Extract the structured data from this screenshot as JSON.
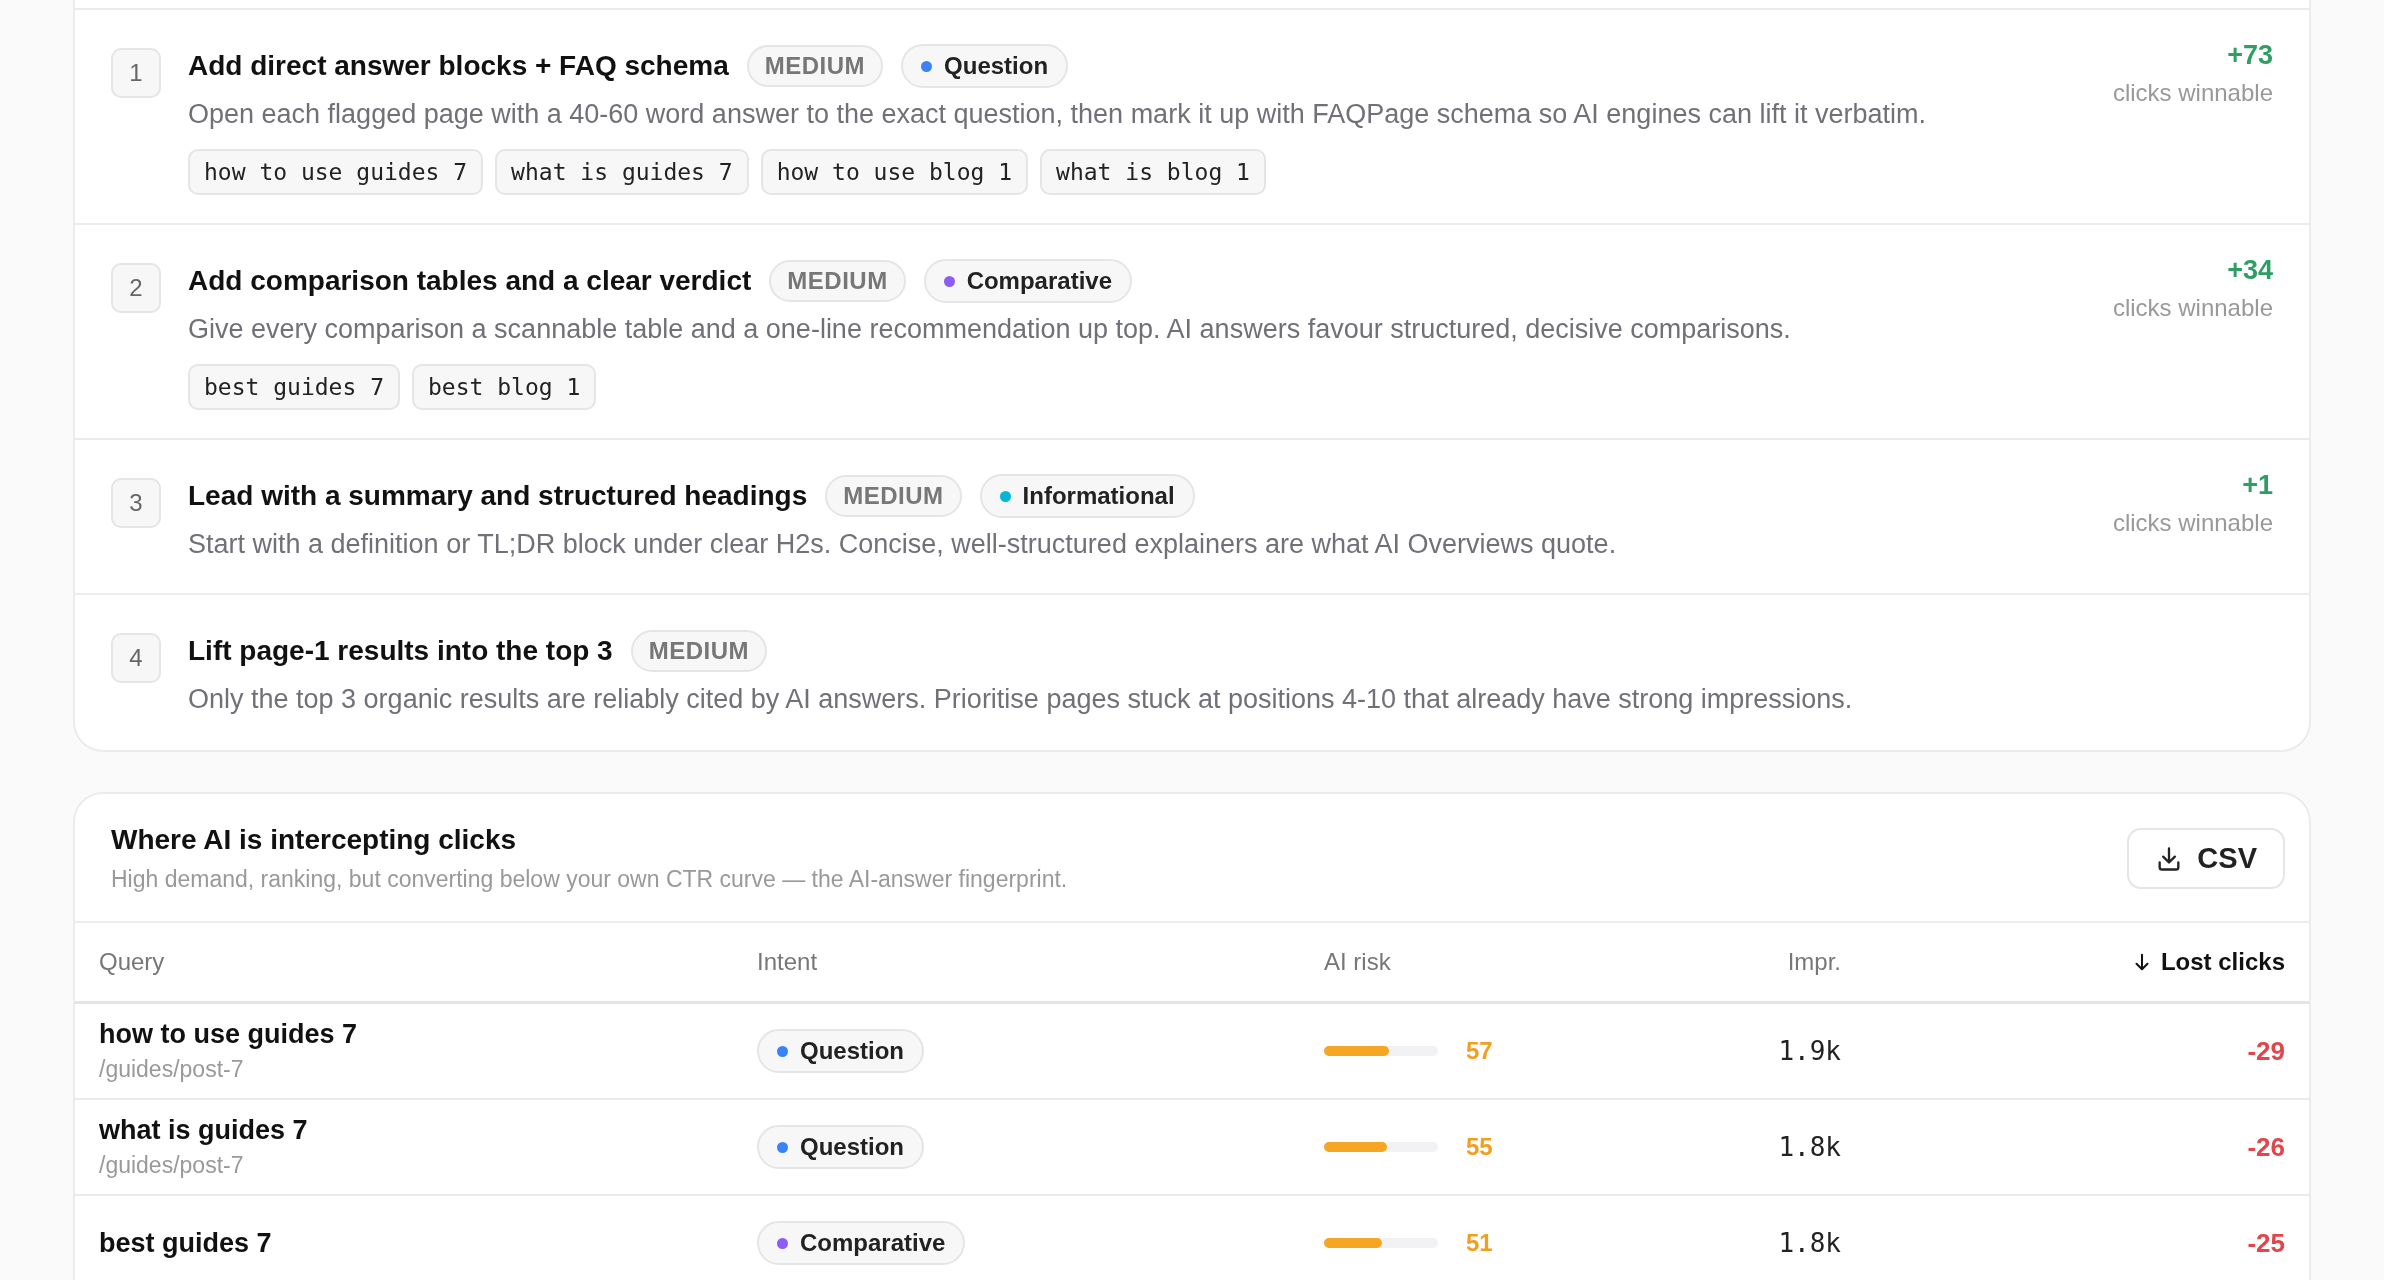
{
  "recommendations": [
    {
      "number": "1",
      "title": "Add direct answer blocks + FAQ schema",
      "effort": "MEDIUM",
      "intent": {
        "label": "Question",
        "color": "#3b82f6"
      },
      "description": "Open each flagged page with a 40-60 word answer to the exact question, then mark it up with FAQPage schema so AI engines can lift it verbatim.",
      "queries": [
        "how to use guides 7",
        "what is guides 7",
        "how to use blog 1",
        "what is blog 1"
      ],
      "gain": "+73",
      "gain_label": "clicks winnable"
    },
    {
      "number": "2",
      "title": "Add comparison tables and a clear verdict",
      "effort": "MEDIUM",
      "intent": {
        "label": "Comparative",
        "color": "#8b5cf6"
      },
      "description": "Give every comparison a scannable table and a one-line recommendation up top. AI answers favour structured, decisive comparisons.",
      "queries": [
        "best guides 7",
        "best blog 1"
      ],
      "gain": "+34",
      "gain_label": "clicks winnable"
    },
    {
      "number": "3",
      "title": "Lead with a summary and structured headings",
      "effort": "MEDIUM",
      "intent": {
        "label": "Informational",
        "color": "#06b6d4"
      },
      "description": "Start with a definition or TL;DR block under clear H2s. Concise, well-structured explainers are what AI Overviews quote.",
      "gain": "+1",
      "gain_label": "clicks winnable"
    },
    {
      "number": "4",
      "title": "Lift page-1 results into the top 3",
      "effort": "MEDIUM",
      "description": "Only the top 3 organic results are reliably cited by AI answers. Prioritise pages stuck at positions 4-10 that already have strong impressions."
    }
  ],
  "intercept": {
    "title": "Where AI is intercepting clicks",
    "subtitle": "High demand, ranking, but converting below your own CTR curve — the AI-answer fingerprint.",
    "csv_button": "CSV",
    "columns": [
      {
        "label": "Query",
        "sorted": false
      },
      {
        "label": "Intent",
        "sorted": false
      },
      {
        "label": "AI risk",
        "sorted": false
      },
      {
        "label": "Impr.",
        "sorted": false
      },
      {
        "label": "Lost clicks",
        "sorted": true
      }
    ],
    "rows": [
      {
        "query": "how to use guides 7",
        "path": "/guides/post-7",
        "intent": {
          "label": "Question",
          "color": "#3b82f6"
        },
        "risk": "57",
        "level": 0.57,
        "impressions": "1.9k",
        "lost": "-29"
      },
      {
        "query": "what is guides 7",
        "path": "/guides/post-7",
        "intent": {
          "label": "Question",
          "color": "#3b82f6"
        },
        "risk": "55",
        "level": 0.55,
        "impressions": "1.8k",
        "lost": "-26"
      },
      {
        "query": "best guides 7",
        "intent": {
          "label": "Comparative",
          "color": "#8b5cf6"
        },
        "risk": "51",
        "level": 0.51,
        "impressions": "1.8k",
        "lost": "-25"
      }
    ]
  }
}
